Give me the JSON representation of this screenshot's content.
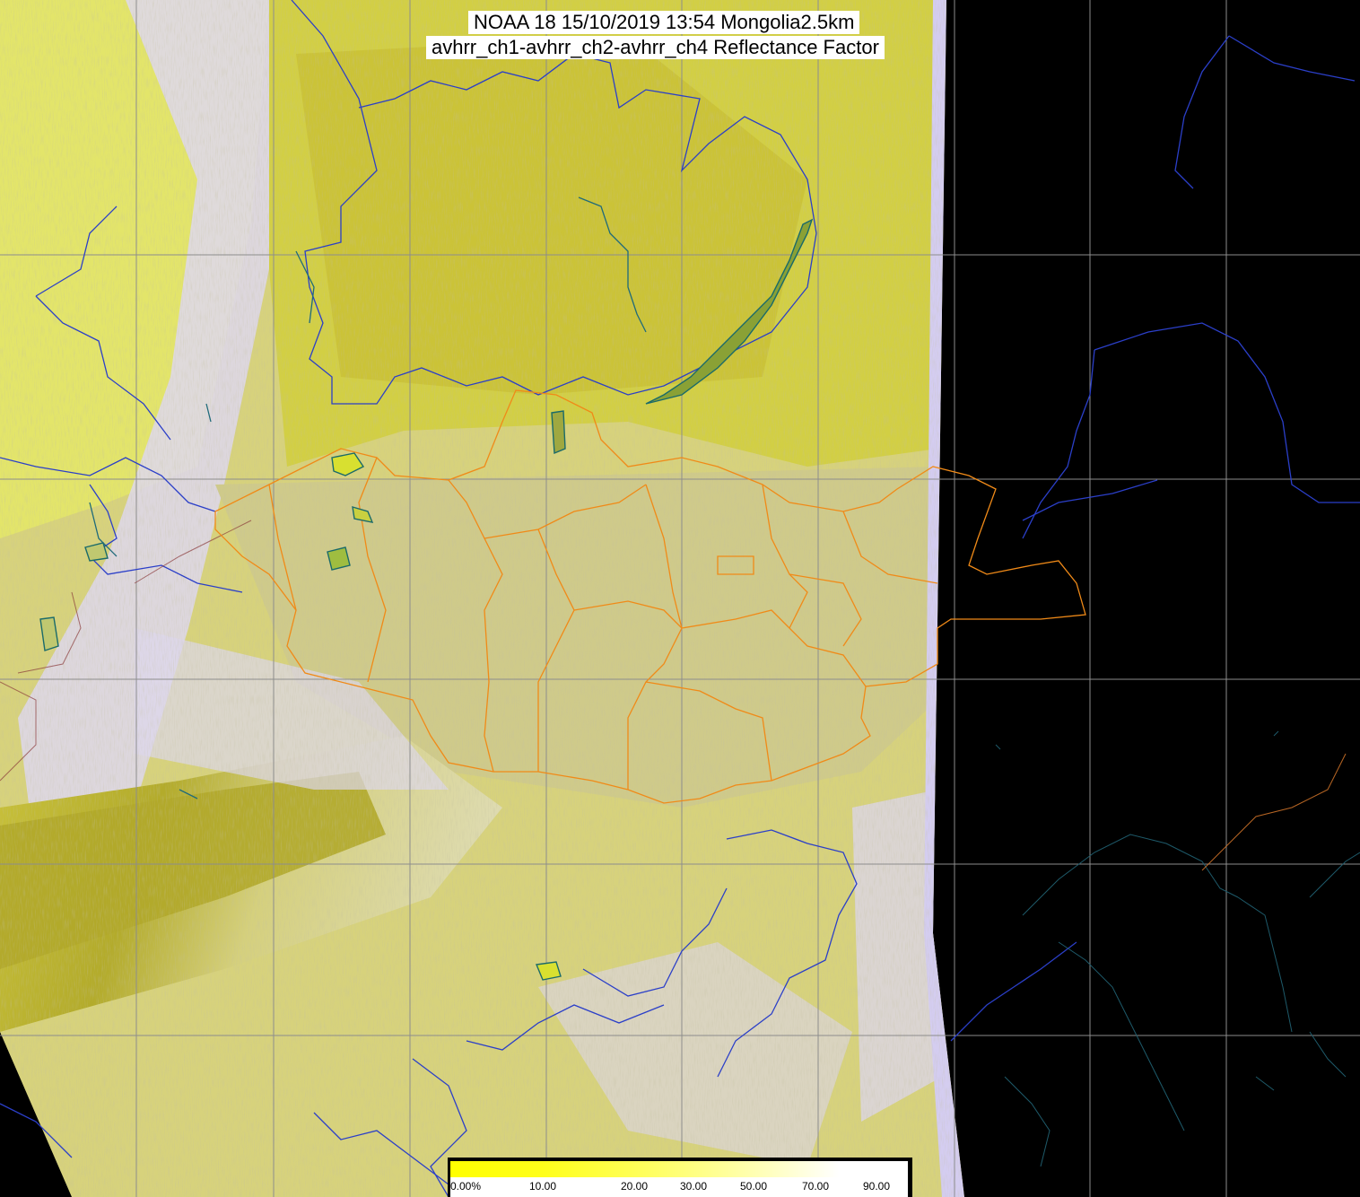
{
  "title": {
    "line1": "NOAA 18 15/10/2019 13:54 Mongolia2.5km",
    "line2": "avhrr_ch1-avhrr_ch2-avhrr_ch4 Reflectance Factor"
  },
  "colorbar": {
    "labels": [
      "0.00%",
      "10.00",
      "20.00",
      "30.00",
      "50.00",
      "70.00",
      "90.00"
    ]
  },
  "colors": {
    "background": "#000000",
    "swath_base": "#d6d27a",
    "swath_yellow": "#d8dd3a",
    "olive": "#a9a21c",
    "cloud": "#d9d4f2",
    "grid": "#8a8a8a",
    "country_border": "#2b3fc8",
    "province_border": "#f08a18",
    "water": "#1f8a7a",
    "coast_dark": "#1a6a6a"
  }
}
